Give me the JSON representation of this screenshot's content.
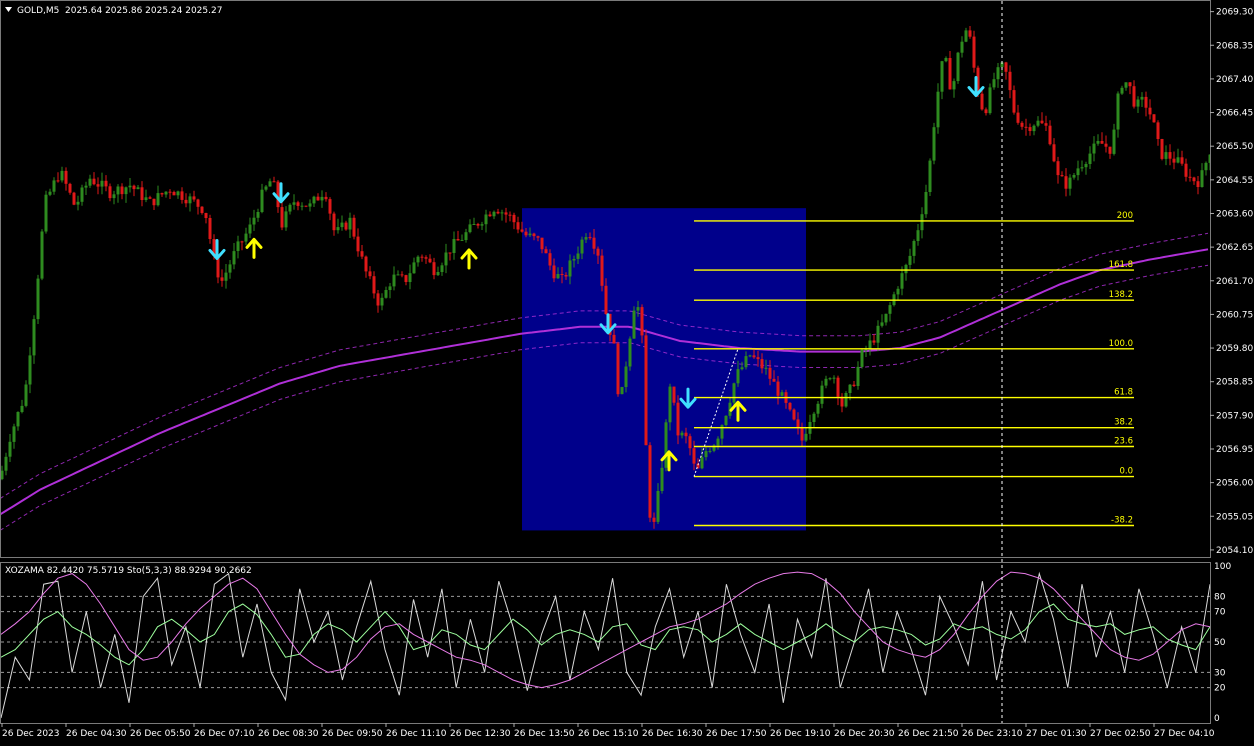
{
  "header": {
    "symbol": "GOLD,M5",
    "ohlc": "2025.64 2025.86 2025.24 2025.27"
  },
  "indicator_header": "XOZAMA 82.4420 75.5719  Sto(5,3,3) 88.9294 90.2662",
  "colors": {
    "background": "#000000",
    "grid": "#3c3c3c",
    "bull_bar": "#2e8b1f",
    "bear_bar": "#e01919",
    "ma_main": "#b030d8",
    "ma_band": "#b030d8",
    "box": "#00008b",
    "fib": "#ffff00",
    "down_arrow": "#40e0ff",
    "up_arrow": "#ffff00",
    "axis_text": "#ffffff",
    "stoch_main": "#ffffff",
    "stoch_signal": "#9dff9d",
    "xozama": "#e87be8"
  },
  "chart_data": [
    {
      "type": "candlestick",
      "title": "GOLD,M5",
      "ylim": [
        2053.9,
        2069.6
      ],
      "y_ticks": [
        "2069.30",
        "2068.35",
        "2067.40",
        "2066.45",
        "2065.50",
        "2064.55",
        "2063.60",
        "2062.65",
        "2061.70",
        "2060.75",
        "2059.80",
        "2058.85",
        "2057.90",
        "2056.95",
        "2056.00",
        "2055.05",
        "2054.10"
      ],
      "x_ticks": [
        "26 Dec 2023",
        "26 Dec 04:30",
        "26 Dec 05:50",
        "26 Dec 07:10",
        "26 Dec 08:30",
        "26 Dec 09:50",
        "26 Dec 11:10",
        "26 Dec 12:30",
        "26 Dec 13:50",
        "26 Dec 15:10",
        "26 Dec 16:30",
        "26 Dec 17:50",
        "26 Dec 19:10",
        "26 Dec 20:30",
        "26 Dec 21:50",
        "26 Dec 23:10",
        "27 Dec 01:30",
        "27 Dec 02:50",
        "27 Dec 04:10"
      ],
      "price_path": [
        [
          0,
          2056.1
        ],
        [
          10,
          2057.3
        ],
        [
          25,
          2058.5
        ],
        [
          35,
          2061.0
        ],
        [
          45,
          2063.9
        ],
        [
          60,
          2064.8
        ],
        [
          75,
          2063.8
        ],
        [
          90,
          2064.6
        ],
        [
          110,
          2064.2
        ],
        [
          130,
          2064.4
        ],
        [
          150,
          2063.9
        ],
        [
          170,
          2064.3
        ],
        [
          190,
          2064.0
        ],
        [
          205,
          2063.7
        ],
        [
          215,
          2062.1
        ],
        [
          222,
          2061.7
        ],
        [
          235,
          2062.5
        ],
        [
          250,
          2063.2
        ],
        [
          262,
          2064.1
        ],
        [
          272,
          2064.6
        ],
        [
          282,
          2063.3
        ],
        [
          295,
          2064.0
        ],
        [
          310,
          2063.8
        ],
        [
          325,
          2064.3
        ],
        [
          335,
          2063.0
        ],
        [
          350,
          2063.4
        ],
        [
          365,
          2062.0
        ],
        [
          380,
          2061.0
        ],
        [
          392,
          2061.8
        ],
        [
          405,
          2061.7
        ],
        [
          420,
          2062.5
        ],
        [
          435,
          2062.0
        ],
        [
          450,
          2062.6
        ],
        [
          465,
          2063.0
        ],
        [
          480,
          2063.4
        ],
        [
          495,
          2063.8
        ],
        [
          510,
          2063.5
        ],
        [
          525,
          2063.0
        ],
        [
          540,
          2062.8
        ],
        [
          552,
          2062.0
        ],
        [
          562,
          2061.7
        ],
        [
          575,
          2062.4
        ],
        [
          588,
          2063.2
        ],
        [
          598,
          2062.5
        ],
        [
          606,
          2060.8
        ],
        [
          614,
          2059.8
        ],
        [
          620,
          2058.1
        ],
        [
          628,
          2059.8
        ],
        [
          636,
          2061.4
        ],
        [
          642,
          2060.0
        ],
        [
          648,
          2055.5
        ],
        [
          653,
          2054.6
        ],
        [
          658,
          2055.6
        ],
        [
          664,
          2057.0
        ],
        [
          670,
          2058.8
        ],
        [
          678,
          2057.4
        ],
        [
          688,
          2057.2
        ],
        [
          696,
          2056.2
        ],
        [
          706,
          2056.9
        ],
        [
          716,
          2057.2
        ],
        [
          726,
          2058.0
        ],
        [
          736,
          2059.0
        ],
        [
          750,
          2059.6
        ],
        [
          765,
          2059.2
        ],
        [
          780,
          2058.5
        ],
        [
          792,
          2057.8
        ],
        [
          802,
          2057.2
        ],
        [
          812,
          2058.0
        ],
        [
          822,
          2058.6
        ],
        [
          832,
          2059.2
        ],
        [
          842,
          2058.2
        ],
        [
          852,
          2058.7
        ],
        [
          862,
          2059.6
        ],
        [
          872,
          2060.0
        ],
        [
          885,
          2060.6
        ],
        [
          898,
          2061.6
        ],
        [
          908,
          2062.2
        ],
        [
          918,
          2063.2
        ],
        [
          928,
          2064.5
        ],
        [
          936,
          2066.7
        ],
        [
          944,
          2068.1
        ],
        [
          952,
          2067.0
        ],
        [
          960,
          2068.4
        ],
        [
          968,
          2068.9
        ],
        [
          976,
          2067.3
        ],
        [
          984,
          2066.4
        ],
        [
          994,
          2067.4
        ],
        [
          1004,
          2067.8
        ],
        [
          1014,
          2066.5
        ],
        [
          1024,
          2066.0
        ],
        [
          1036,
          2066.2
        ],
        [
          1048,
          2066.0
        ],
        [
          1058,
          2064.6
        ],
        [
          1068,
          2064.4
        ],
        [
          1078,
          2064.9
        ],
        [
          1090,
          2065.3
        ],
        [
          1100,
          2065.6
        ],
        [
          1112,
          2065.4
        ],
        [
          1120,
          2067.3
        ],
        [
          1128,
          2067.3
        ],
        [
          1136,
          2066.6
        ],
        [
          1144,
          2066.8
        ],
        [
          1152,
          2066.3
        ],
        [
          1160,
          2065.3
        ],
        [
          1170,
          2065.2
        ],
        [
          1180,
          2065.0
        ],
        [
          1190,
          2064.6
        ],
        [
          1200,
          2064.5
        ],
        [
          1210,
          2065.4
        ]
      ],
      "moving_average": [
        [
          0,
          2055.1
        ],
        [
          40,
          2055.8
        ],
        [
          100,
          2056.6
        ],
        [
          160,
          2057.4
        ],
        [
          220,
          2058.1
        ],
        [
          280,
          2058.8
        ],
        [
          340,
          2059.3
        ],
        [
          400,
          2059.6
        ],
        [
          460,
          2059.9
        ],
        [
          520,
          2060.2
        ],
        [
          580,
          2060.4
        ],
        [
          630,
          2060.4
        ],
        [
          680,
          2060.0
        ],
        [
          740,
          2059.8
        ],
        [
          800,
          2059.7
        ],
        [
          860,
          2059.7
        ],
        [
          900,
          2059.8
        ],
        [
          940,
          2060.1
        ],
        [
          980,
          2060.6
        ],
        [
          1020,
          2061.1
        ],
        [
          1060,
          2061.6
        ],
        [
          1100,
          2062.0
        ],
        [
          1150,
          2062.3
        ],
        [
          1210,
          2062.6
        ]
      ],
      "fibonacci": {
        "levels": [
          "200",
          "161.8",
          "138.2",
          "100.0",
          "61.8",
          "38.2",
          "23.6",
          "0.0",
          "-38.2"
        ],
        "prices": [
          2063.39,
          2062.0,
          2061.15,
          2059.78,
          2058.4,
          2057.55,
          2057.02,
          2056.17,
          2054.79
        ],
        "range": [
          2056.17,
          2059.78
        ]
      },
      "highlight_box": {
        "price_top": 2063.75,
        "price_bottom": 2054.65,
        "from_x": 522,
        "to_x": 806
      },
      "signals": [
        {
          "x": 217,
          "price": 2062.5,
          "direction": "down"
        },
        {
          "x": 254,
          "price": 2062.7,
          "direction": "up"
        },
        {
          "x": 281,
          "price": 2064.1,
          "direction": "down"
        },
        {
          "x": 469,
          "price": 2062.4,
          "direction": "up"
        },
        {
          "x": 608,
          "price": 2060.4,
          "direction": "down"
        },
        {
          "x": 669,
          "price": 2056.7,
          "direction": "up"
        },
        {
          "x": 688,
          "price": 2058.3,
          "direction": "down"
        },
        {
          "x": 738,
          "price": 2058.1,
          "direction": "up"
        },
        {
          "x": 976,
          "price": 2067.1,
          "direction": "down"
        }
      ]
    },
    {
      "type": "line",
      "title": "XOZAMA 82.4420 75.5719  Sto(5,3,3) 88.9294 90.2662",
      "ylim": [
        0,
        100
      ],
      "y_ticks": [
        "100",
        "80",
        "70",
        "50",
        "30",
        "20",
        "0"
      ],
      "levels": [
        20,
        30,
        50,
        70,
        80
      ],
      "series": [
        {
          "name": "Sto(5,3,3)",
          "color_key": "stoch_main",
          "values": [
            0,
            40,
            25,
            88,
            90,
            30,
            70,
            20,
            55,
            10,
            80,
            92,
            35,
            60,
            20,
            88,
            95,
            40,
            75,
            30,
            12,
            85,
            50,
            70,
            25,
            60,
            90,
            45,
            15,
            78,
            40,
            85,
            20,
            65,
            30,
            90,
            60,
            18,
            55,
            80,
            25,
            70,
            45,
            92,
            30,
            15,
            60,
            85,
            40,
            70,
            20,
            88,
            55,
            30,
            75,
            10,
            65,
            40,
            92,
            20,
            50,
            85,
            30,
            70,
            45,
            15,
            80,
            60,
            35,
            90,
            25,
            70,
            50,
            95,
            65,
            20,
            88,
            40,
            70,
            30,
            85,
            55,
            20,
            60,
            30,
            88
          ]
        },
        {
          "name": "Signal",
          "color_key": "stoch_signal",
          "values": [
            40,
            45,
            55,
            65,
            70,
            60,
            55,
            48,
            40,
            35,
            45,
            60,
            65,
            58,
            50,
            55,
            70,
            75,
            68,
            55,
            40,
            42,
            55,
            62,
            58,
            50,
            60,
            70,
            60,
            45,
            48,
            58,
            55,
            48,
            45,
            55,
            65,
            58,
            48,
            55,
            58,
            55,
            50,
            60,
            62,
            48,
            45,
            58,
            60,
            58,
            50,
            55,
            62,
            55,
            50,
            45,
            50,
            55,
            62,
            55,
            50,
            58,
            60,
            58,
            55,
            48,
            52,
            62,
            58,
            60,
            55,
            52,
            58,
            70,
            75,
            65,
            62,
            60,
            62,
            55,
            58,
            60,
            52,
            48,
            45,
            60
          ]
        },
        {
          "name": "XOZAMA",
          "color_key": "xozama",
          "values": [
            55,
            62,
            70,
            82,
            92,
            95,
            88,
            75,
            60,
            45,
            38,
            40,
            50,
            62,
            72,
            80,
            88,
            92,
            85,
            70,
            55,
            42,
            35,
            30,
            32,
            40,
            52,
            60,
            62,
            55,
            50,
            45,
            40,
            38,
            35,
            30,
            25,
            22,
            20,
            22,
            25,
            30,
            35,
            40,
            45,
            50,
            55,
            60,
            62,
            65,
            70,
            75,
            82,
            88,
            92,
            95,
            96,
            95,
            90,
            82,
            70,
            60,
            50,
            45,
            42,
            40,
            45,
            55,
            68,
            80,
            90,
            96,
            95,
            92,
            85,
            75,
            65,
            55,
            45,
            40,
            38,
            42,
            50,
            58,
            62,
            60
          ]
        }
      ]
    }
  ]
}
